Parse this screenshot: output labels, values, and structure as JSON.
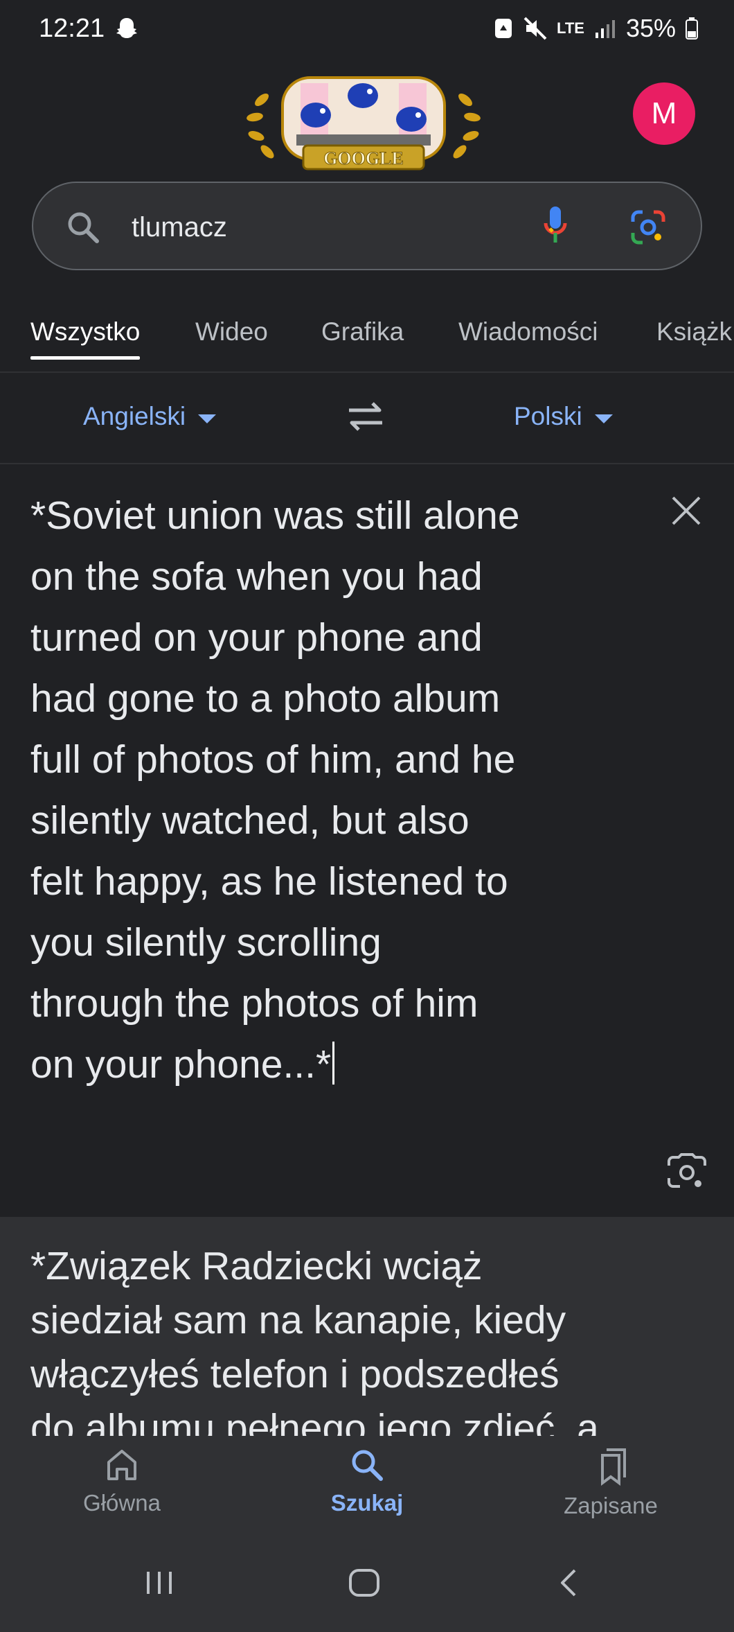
{
  "status_bar": {
    "time": "12:21",
    "network": "LTE",
    "battery": "35%"
  },
  "header": {
    "doodle_text": "GOOGLE",
    "avatar_letter": "M"
  },
  "search": {
    "query": "tlumacz"
  },
  "tabs": [
    {
      "label": "Wszystko",
      "active": true
    },
    {
      "label": "Wideo",
      "active": false
    },
    {
      "label": "Grafika",
      "active": false
    },
    {
      "label": "Wiadomości",
      "active": false
    },
    {
      "label": "Książk",
      "active": false
    }
  ],
  "translator": {
    "source_language": "Angielski",
    "target_language": "Polski",
    "source_lines": [
      "*Soviet union was still alone",
      "on the sofa when you had",
      "turned on your phone and",
      "had gone to a photo album",
      "full of photos of him, and he",
      "silently watched, but also",
      "felt happy, as he listened to",
      "you silently scrolling",
      "through the photos of him",
      "on your phone...*"
    ],
    "translation_lines": [
      "*Związek Radziecki wciąż",
      "siedział sam na kanapie, kiedy",
      "włączyłeś telefon i podszedłeś",
      "do albumu pełnego jego zdjęć, a"
    ]
  },
  "bottom_nav": [
    {
      "label": "Główna",
      "icon": "home-icon",
      "active": false
    },
    {
      "label": "Szukaj",
      "icon": "search-icon",
      "active": true
    },
    {
      "label": "Zapisane",
      "icon": "bookmarks-icon",
      "active": false
    }
  ],
  "colors": {
    "background": "#202124",
    "panel": "#303134",
    "accent": "#8ab4f8",
    "avatar": "#e91e63"
  }
}
